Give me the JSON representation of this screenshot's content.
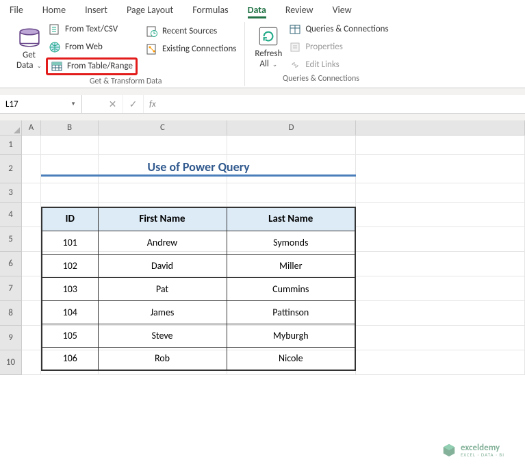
{
  "tabs": {
    "items": [
      "File",
      "Home",
      "Insert",
      "Page Layout",
      "Formulas",
      "Data",
      "Review",
      "View"
    ],
    "active": 5
  },
  "ribbon": {
    "get_data": "Get\nData",
    "from_text_csv": "From Text/CSV",
    "from_web": "From Web",
    "from_table_range": "From Table/Range",
    "recent_sources": "Recent Sources",
    "existing_connections": "Existing Connections",
    "group1": "Get & Transform Data",
    "refresh_all": "Refresh\nAll",
    "queries_connections": "Queries & Connections",
    "properties": "Properties",
    "edit_links": "Edit Links",
    "group2": "Queries & Connections"
  },
  "namebox": "L17",
  "fx": "fx",
  "columns": [
    "A",
    "B",
    "C",
    "D"
  ],
  "rownums": [
    "1",
    "2",
    "3",
    "4",
    "5",
    "6",
    "7",
    "8",
    "9",
    "10"
  ],
  "title": "Use of Power Query",
  "chart_data": {
    "type": "table",
    "headers": [
      "ID",
      "First Name",
      "Last Name"
    ],
    "rows": [
      [
        "101",
        "Andrew",
        "Symonds"
      ],
      [
        "102",
        "David",
        "Miller"
      ],
      [
        "103",
        "Pat",
        "Cummins"
      ],
      [
        "104",
        "James",
        "Pattinson"
      ],
      [
        "105",
        "Steve",
        "Myburgh"
      ],
      [
        "106",
        "Rob",
        "Nicole"
      ]
    ]
  },
  "watermark": {
    "name": "exceldemy",
    "sub": "EXCEL · DATA · BI"
  }
}
